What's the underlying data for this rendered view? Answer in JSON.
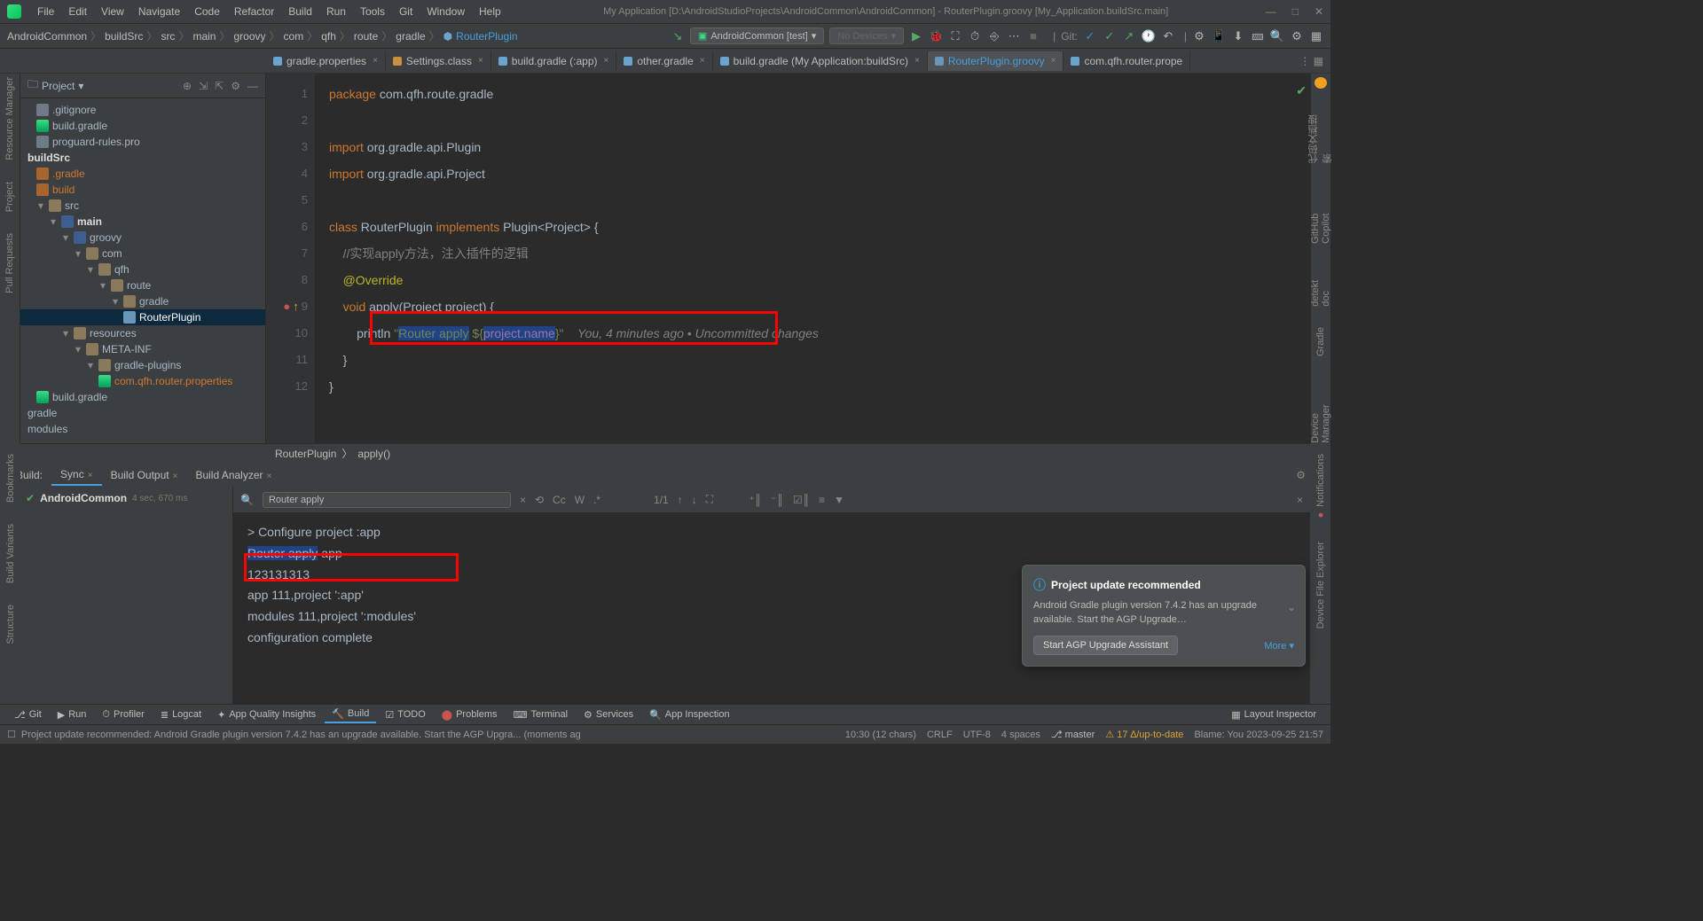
{
  "window": {
    "title": "My Application [D:\\AndroidStudioProjects\\AndroidCommon\\AndroidCommon] - RouterPlugin.groovy [My_Application.buildSrc.main]"
  },
  "menu": {
    "file": "File",
    "edit": "Edit",
    "view": "View",
    "navigate": "Navigate",
    "code": "Code",
    "refactor": "Refactor",
    "build": "Build",
    "run": "Run",
    "tools": "Tools",
    "git": "Git",
    "window": "Window",
    "help": "Help"
  },
  "breadcrumbs": {
    "b0": "AndroidCommon",
    "b1": "buildSrc",
    "b2": "src",
    "b3": "main",
    "b4": "groovy",
    "b5": "com",
    "b6": "qfh",
    "b7": "route",
    "b8": "gradle",
    "b9": "RouterPlugin"
  },
  "runconfig": {
    "module": "AndroidCommon [test]",
    "devices": "No Devices"
  },
  "toolbar": {
    "git_label": "Git:"
  },
  "editor_tabs": {
    "t0": "gradle.properties",
    "t1": "Settings.class",
    "t2": "build.gradle (:app)",
    "t3": "other.gradle",
    "t4": "build.gradle (My Application:buildSrc)",
    "t5": "RouterPlugin.groovy",
    "t6": "com.qfh.router.prope"
  },
  "project": {
    "header": "Project",
    "items": {
      "gitignore": ".gitignore",
      "buildgradle": "build.gradle",
      "proguard": "proguard-rules.pro",
      "buildSrc": "buildSrc",
      "gradleDir": ".gradle",
      "buildDir": "build",
      "srcDir": "src",
      "mainDir": "main",
      "groovyDir": "groovy",
      "comDir": "com",
      "qfhDir": "qfh",
      "routeDir": "route",
      "gradlePkg": "gradle",
      "routerPlugin": "RouterPlugin",
      "resources": "resources",
      "metaInf": "META-INF",
      "gradlePlugins": "gradle-plugins",
      "routerProps": "com.qfh.router.properties",
      "buildgradle2": "build.gradle",
      "gradleRoot": "gradle",
      "modules": "modules"
    }
  },
  "code": {
    "l1a": "package",
    "l1b": " com.qfh.route.gradle",
    "l3a": "import",
    "l3b": " org.gradle.api.Plugin",
    "l4a": "import",
    "l4b": " org.gradle.api.Project",
    "l6a": "class",
    "l6b": " RouterPlugin ",
    "l6c": "implements",
    "l6d": " Plugin<Project> {",
    "l7": "//实现apply方法，注入插件的逻辑",
    "l8": "@Override",
    "l9a": "void",
    "l9b": " apply(Project project) {",
    "l10a": "println ",
    "l10b": "\"",
    "l10sel": "Router apply",
    "l10c": " ${",
    "l10prop": "project.name",
    "l10d": "}\"",
    "l10hint": "You, 4 minutes ago • Uncommitted changes",
    "l11": "}",
    "l12": "}"
  },
  "editor_bc": {
    "a": "RouterPlugin",
    "b": "apply()"
  },
  "build": {
    "label": "Build:",
    "tab_sync": "Sync",
    "tab_output": "Build Output",
    "tab_analyzer": "Build Analyzer",
    "sync_project": "AndroidCommon",
    "sync_time": "4 sec, 670 ms",
    "search_value": "Router apply",
    "search_counter": "1/1",
    "search_cc": "Cc",
    "search_w": "W",
    "search_star": ".*",
    "out1": "> Configure project :app",
    "out2_sel": "Router apply",
    "out2_rest": " app",
    "out3": "123131313",
    "out4": "app 111,project ':app'",
    "out5": "modules 111,project ':modules'",
    "out6": "configuration complete"
  },
  "notif": {
    "title": "Project update recommended",
    "body": "Android Gradle plugin version 7.4.2 has an upgrade available. Start the AGP Upgrade…",
    "btn": "Start AGP Upgrade Assistant",
    "more": "More ▾"
  },
  "bottom": {
    "git": "Git",
    "run": "Run",
    "profiler": "Profiler",
    "logcat": "Logcat",
    "appq": "App Quality Insights",
    "build": "Build",
    "todo": "TODO",
    "problems": "Problems",
    "terminal": "Terminal",
    "services": "Services",
    "appinsp": "App Inspection",
    "layoutinsp": "Layout Inspector"
  },
  "status": {
    "msg": "Project update recommended: Android Gradle plugin version 7.4.2 has an upgrade available.  Start the AGP Upgra... (moments ag",
    "pos": "10:30 (12 chars)",
    "eol": "CRLF",
    "enc": "UTF-8",
    "indent": "4 spaces",
    "branch": "master",
    "ahead": "17 ∆/up-to-date",
    "blame": "Blame: You 2023-09-25 21:57"
  },
  "left_tools": {
    "rm": "Resource Manager",
    "proj": "Project",
    "pr": "Pull Requests",
    "bm": "Bookmarks",
    "bv": "Build Variants",
    "st": "Structure"
  },
  "right_tools": {
    "a": "代码文档搜索",
    "gh": "GitHub Copilot",
    "dd": "detekt doc",
    "gr": "Gradle",
    "dm": "Device Manager",
    "no": "Notifications",
    "de": "Device File Explorer"
  }
}
